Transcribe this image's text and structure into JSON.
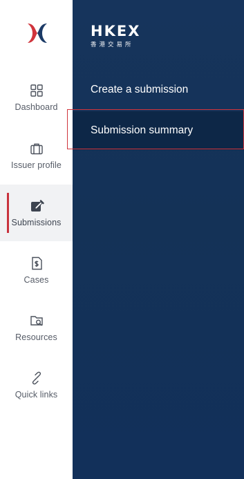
{
  "rail": {
    "items": [
      {
        "label": "Dashboard",
        "icon": "dashboard-icon"
      },
      {
        "label": "Issuer profile",
        "icon": "briefcase-icon"
      },
      {
        "label": "Submissions",
        "icon": "edit-icon",
        "active": true
      },
      {
        "label": "Cases",
        "icon": "document-dollar-icon"
      },
      {
        "label": "Resources",
        "icon": "folder-search-icon"
      },
      {
        "label": "Quick links",
        "icon": "link-icon"
      }
    ]
  },
  "brand": {
    "name": "HKEX",
    "subtitle": "香港交易所"
  },
  "menu": {
    "items": [
      {
        "label": "Create a submission"
      },
      {
        "label": "Submission summary",
        "selected": true
      }
    ]
  },
  "colors": {
    "panel": "#143257",
    "selected_row": "#0d2747",
    "accent_red": "#c8323d",
    "rail_text": "#555b66"
  }
}
